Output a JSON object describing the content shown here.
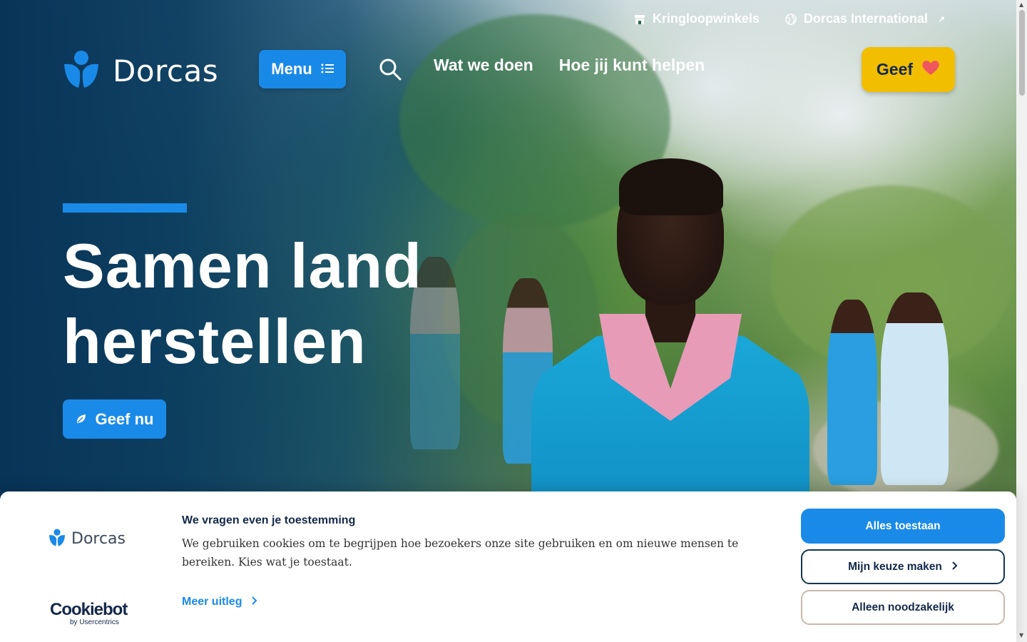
{
  "utility": {
    "stores_label": "Kringloopwinkels",
    "international_label": "Dorcas International",
    "external_arrow": "↗"
  },
  "header": {
    "logo_text": "Dorcas",
    "menu_label": "Menu",
    "nav": [
      "Wat we doen",
      "Hoe jij kunt helpen"
    ],
    "give_label": "Geef"
  },
  "hero": {
    "title_line1": "Samen land",
    "title_line2": "herstellen",
    "cta_label": "Geef nu"
  },
  "cookie": {
    "logo_text": "Dorcas",
    "title": "We vragen even je toestemming",
    "body": "We gebruiken cookies om te begrijpen hoe bezoekers onze site gebruiken en om nieuwe mensen te bereiken. Kies wat je toestaat.",
    "more_label": "Meer uitleg",
    "allow_all": "Alles toestaan",
    "choose": "Mijn keuze maken",
    "necessary_only": "Alleen noodzakelijk",
    "cookiebot": "Cookiebot",
    "cookiebot_sub": "by Usercentrics"
  },
  "colors": {
    "brand_blue": "#1a8ae8",
    "give_yellow": "#f2be00",
    "navy": "#14284a",
    "heart": "#f0565e"
  }
}
